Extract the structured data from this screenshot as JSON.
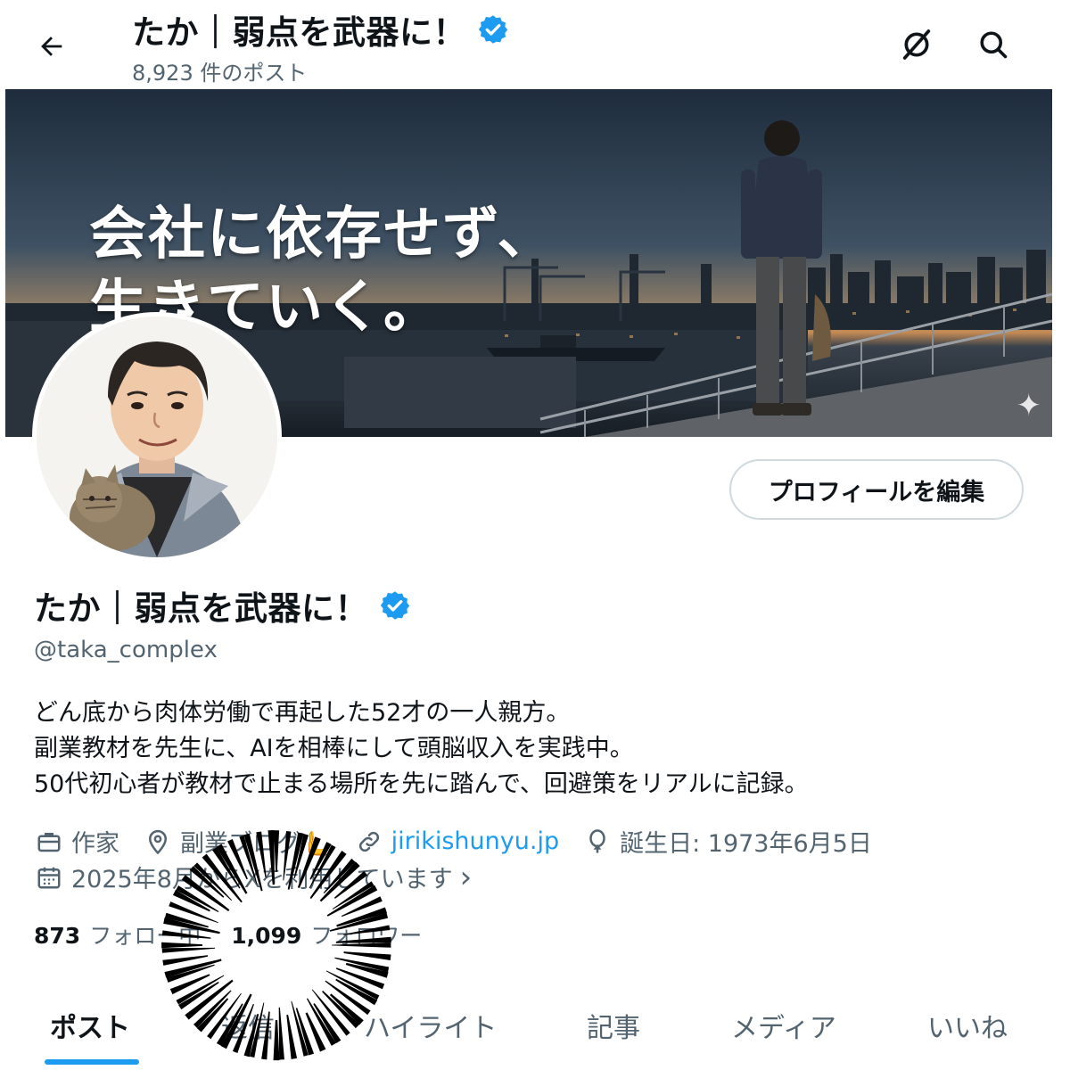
{
  "header": {
    "title": "たか｜弱点を武器に！",
    "post_count": "8,923 件のポスト",
    "back_icon": "arrow-left-icon",
    "grok_icon": "grok-icon",
    "search_icon": "search-icon"
  },
  "banner": {
    "line1": "会社に依存せず、",
    "line2": "生きていく。"
  },
  "profile": {
    "edit_button": "プロフィールを編集",
    "name": "たか｜弱点を武器に！",
    "handle": "@taka_complex",
    "verified_color": "#1d9bf0",
    "bio": [
      "どん底から肉体労働で再起した52才の一人親方。",
      "副業教材を先生に、AIを相棒にして頭脳収入を実践中。",
      "50代初心者が教材で止まる場所を先に踏んで、回避策をリアルに記録。"
    ]
  },
  "meta": {
    "job": "作家",
    "location": "副業ブログ🫷",
    "link": "jirikishunyu.jp",
    "birthday": "誕生日: 1973年6月5日",
    "joined": "2025年8月からXを利用しています",
    "joined_chevron": "›"
  },
  "follow": {
    "following_count": "873",
    "following_label": "フォロー中",
    "followers_count": "1,099",
    "followers_label": "フォロワー"
  },
  "tabs": [
    {
      "label": "ポスト"
    },
    {
      "label": "返信"
    },
    {
      "label": "ハイライト"
    },
    {
      "label": "記事"
    },
    {
      "label": "メディア"
    },
    {
      "label": "いいね"
    }
  ],
  "colors": {
    "accent": "#1d9bf0",
    "text": "#0f1419",
    "muted": "#536471"
  }
}
